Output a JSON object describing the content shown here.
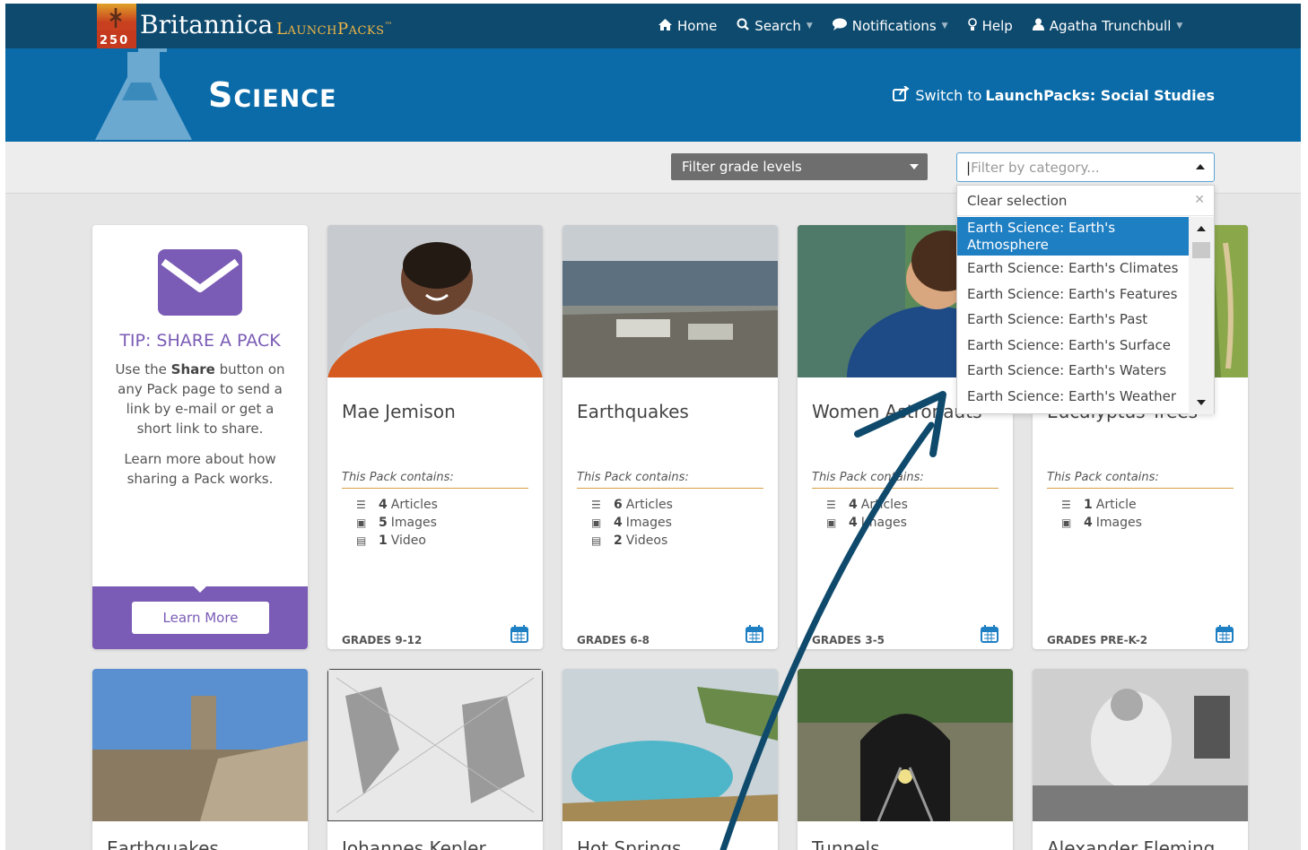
{
  "logo": {
    "badge_number": "250",
    "brand": "Britannica",
    "product": "LaunchPacks",
    "trademark": "™"
  },
  "nav": {
    "home": "Home",
    "search": "Search",
    "notifications": "Notifications",
    "help": "Help",
    "user": "Agatha Trunchbull"
  },
  "hero": {
    "title": "Science",
    "switch_prefix": "Switch to",
    "switch_target": "LaunchPacks: Social Studies"
  },
  "filters": {
    "grade_label": "Filter grade levels",
    "category_placeholder": "Filter by category..."
  },
  "dropdown": {
    "clear": "Clear selection",
    "options": [
      "Earth Science: Earth's Atmosphere",
      "Earth Science: Earth's Climates",
      "Earth Science: Earth's Features",
      "Earth Science: Earth's Past",
      "Earth Science: Earth's Surface",
      "Earth Science: Earth's Waters",
      "Earth Science: Earth's Weather"
    ]
  },
  "tip": {
    "title": "TIP: SHARE A PACK",
    "body_pre": "Use the",
    "body_bold": "Share",
    "body_post": "button on any Pack page to send a link by e-mail or get a short link to share.",
    "body2": "Learn more about how sharing a Pack works.",
    "button": "Learn More"
  },
  "contains_label": "This Pack contains:",
  "cards": [
    {
      "title": "Mae Jemison",
      "articles_n": "4",
      "articles_w": "Articles",
      "images_n": "5",
      "images_w": "Images",
      "videos_n": "1",
      "videos_w": "Video",
      "grades": "GRADES 9-12"
    },
    {
      "title": "Earthquakes",
      "articles_n": "6",
      "articles_w": "Articles",
      "images_n": "4",
      "images_w": "Images",
      "videos_n": "2",
      "videos_w": "Videos",
      "grades": "GRADES 6-8"
    },
    {
      "title": "Women Astronauts",
      "articles_n": "4",
      "articles_w": "Articles",
      "images_n": "4",
      "images_w": "Images",
      "grades": "GRADES 3-5"
    },
    {
      "title": "Eucalyptus Trees",
      "articles_n": "1",
      "articles_w": "Article",
      "images_n": "4",
      "images_w": "Images",
      "grades": "GRADES PRE-K-2"
    }
  ],
  "row2_titles": [
    "Earthquakes",
    "Johannes Kepler",
    "Hot Springs",
    "Tunnels",
    "Alexander Fleming"
  ],
  "colors": {
    "nav_bg": "#0d4a6e",
    "hero_bg": "#0a6ba8",
    "tip_purple": "#7a5bb5",
    "dropdown_highlight": "#1f7fc3",
    "accent_rule": "#d9a046",
    "annotation_arrow": "#0f4a6c"
  }
}
